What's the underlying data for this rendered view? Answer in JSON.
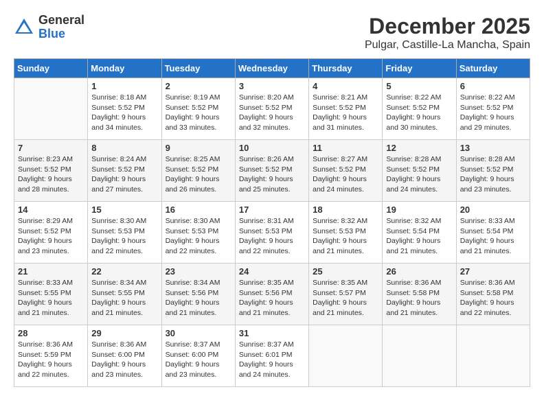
{
  "logo": {
    "general": "General",
    "blue": "Blue"
  },
  "title": "December 2025",
  "location": "Pulgar, Castille-La Mancha, Spain",
  "days_header": [
    "Sunday",
    "Monday",
    "Tuesday",
    "Wednesday",
    "Thursday",
    "Friday",
    "Saturday"
  ],
  "weeks": [
    [
      {
        "day": "",
        "sunrise": "",
        "sunset": "",
        "daylight": ""
      },
      {
        "day": "1",
        "sunrise": "Sunrise: 8:18 AM",
        "sunset": "Sunset: 5:52 PM",
        "daylight": "Daylight: 9 hours and 34 minutes."
      },
      {
        "day": "2",
        "sunrise": "Sunrise: 8:19 AM",
        "sunset": "Sunset: 5:52 PM",
        "daylight": "Daylight: 9 hours and 33 minutes."
      },
      {
        "day": "3",
        "sunrise": "Sunrise: 8:20 AM",
        "sunset": "Sunset: 5:52 PM",
        "daylight": "Daylight: 9 hours and 32 minutes."
      },
      {
        "day": "4",
        "sunrise": "Sunrise: 8:21 AM",
        "sunset": "Sunset: 5:52 PM",
        "daylight": "Daylight: 9 hours and 31 minutes."
      },
      {
        "day": "5",
        "sunrise": "Sunrise: 8:22 AM",
        "sunset": "Sunset: 5:52 PM",
        "daylight": "Daylight: 9 hours and 30 minutes."
      },
      {
        "day": "6",
        "sunrise": "Sunrise: 8:22 AM",
        "sunset": "Sunset: 5:52 PM",
        "daylight": "Daylight: 9 hours and 29 minutes."
      }
    ],
    [
      {
        "day": "7",
        "sunrise": "Sunrise: 8:23 AM",
        "sunset": "Sunset: 5:52 PM",
        "daylight": "Daylight: 9 hours and 28 minutes."
      },
      {
        "day": "8",
        "sunrise": "Sunrise: 8:24 AM",
        "sunset": "Sunset: 5:52 PM",
        "daylight": "Daylight: 9 hours and 27 minutes."
      },
      {
        "day": "9",
        "sunrise": "Sunrise: 8:25 AM",
        "sunset": "Sunset: 5:52 PM",
        "daylight": "Daylight: 9 hours and 26 minutes."
      },
      {
        "day": "10",
        "sunrise": "Sunrise: 8:26 AM",
        "sunset": "Sunset: 5:52 PM",
        "daylight": "Daylight: 9 hours and 25 minutes."
      },
      {
        "day": "11",
        "sunrise": "Sunrise: 8:27 AM",
        "sunset": "Sunset: 5:52 PM",
        "daylight": "Daylight: 9 hours and 24 minutes."
      },
      {
        "day": "12",
        "sunrise": "Sunrise: 8:28 AM",
        "sunset": "Sunset: 5:52 PM",
        "daylight": "Daylight: 9 hours and 24 minutes."
      },
      {
        "day": "13",
        "sunrise": "Sunrise: 8:28 AM",
        "sunset": "Sunset: 5:52 PM",
        "daylight": "Daylight: 9 hours and 23 minutes."
      }
    ],
    [
      {
        "day": "14",
        "sunrise": "Sunrise: 8:29 AM",
        "sunset": "Sunset: 5:52 PM",
        "daylight": "Daylight: 9 hours and 23 minutes."
      },
      {
        "day": "15",
        "sunrise": "Sunrise: 8:30 AM",
        "sunset": "Sunset: 5:53 PM",
        "daylight": "Daylight: 9 hours and 22 minutes."
      },
      {
        "day": "16",
        "sunrise": "Sunrise: 8:30 AM",
        "sunset": "Sunset: 5:53 PM",
        "daylight": "Daylight: 9 hours and 22 minutes."
      },
      {
        "day": "17",
        "sunrise": "Sunrise: 8:31 AM",
        "sunset": "Sunset: 5:53 PM",
        "daylight": "Daylight: 9 hours and 22 minutes."
      },
      {
        "day": "18",
        "sunrise": "Sunrise: 8:32 AM",
        "sunset": "Sunset: 5:53 PM",
        "daylight": "Daylight: 9 hours and 21 minutes."
      },
      {
        "day": "19",
        "sunrise": "Sunrise: 8:32 AM",
        "sunset": "Sunset: 5:54 PM",
        "daylight": "Daylight: 9 hours and 21 minutes."
      },
      {
        "day": "20",
        "sunrise": "Sunrise: 8:33 AM",
        "sunset": "Sunset: 5:54 PM",
        "daylight": "Daylight: 9 hours and 21 minutes."
      }
    ],
    [
      {
        "day": "21",
        "sunrise": "Sunrise: 8:33 AM",
        "sunset": "Sunset: 5:55 PM",
        "daylight": "Daylight: 9 hours and 21 minutes."
      },
      {
        "day": "22",
        "sunrise": "Sunrise: 8:34 AM",
        "sunset": "Sunset: 5:55 PM",
        "daylight": "Daylight: 9 hours and 21 minutes."
      },
      {
        "day": "23",
        "sunrise": "Sunrise: 8:34 AM",
        "sunset": "Sunset: 5:56 PM",
        "daylight": "Daylight: 9 hours and 21 minutes."
      },
      {
        "day": "24",
        "sunrise": "Sunrise: 8:35 AM",
        "sunset": "Sunset: 5:56 PM",
        "daylight": "Daylight: 9 hours and 21 minutes."
      },
      {
        "day": "25",
        "sunrise": "Sunrise: 8:35 AM",
        "sunset": "Sunset: 5:57 PM",
        "daylight": "Daylight: 9 hours and 21 minutes."
      },
      {
        "day": "26",
        "sunrise": "Sunrise: 8:36 AM",
        "sunset": "Sunset: 5:58 PM",
        "daylight": "Daylight: 9 hours and 21 minutes."
      },
      {
        "day": "27",
        "sunrise": "Sunrise: 8:36 AM",
        "sunset": "Sunset: 5:58 PM",
        "daylight": "Daylight: 9 hours and 22 minutes."
      }
    ],
    [
      {
        "day": "28",
        "sunrise": "Sunrise: 8:36 AM",
        "sunset": "Sunset: 5:59 PM",
        "daylight": "Daylight: 9 hours and 22 minutes."
      },
      {
        "day": "29",
        "sunrise": "Sunrise: 8:36 AM",
        "sunset": "Sunset: 6:00 PM",
        "daylight": "Daylight: 9 hours and 23 minutes."
      },
      {
        "day": "30",
        "sunrise": "Sunrise: 8:37 AM",
        "sunset": "Sunset: 6:00 PM",
        "daylight": "Daylight: 9 hours and 23 minutes."
      },
      {
        "day": "31",
        "sunrise": "Sunrise: 8:37 AM",
        "sunset": "Sunset: 6:01 PM",
        "daylight": "Daylight: 9 hours and 24 minutes."
      },
      {
        "day": "",
        "sunrise": "",
        "sunset": "",
        "daylight": ""
      },
      {
        "day": "",
        "sunrise": "",
        "sunset": "",
        "daylight": ""
      },
      {
        "day": "",
        "sunrise": "",
        "sunset": "",
        "daylight": ""
      }
    ]
  ]
}
